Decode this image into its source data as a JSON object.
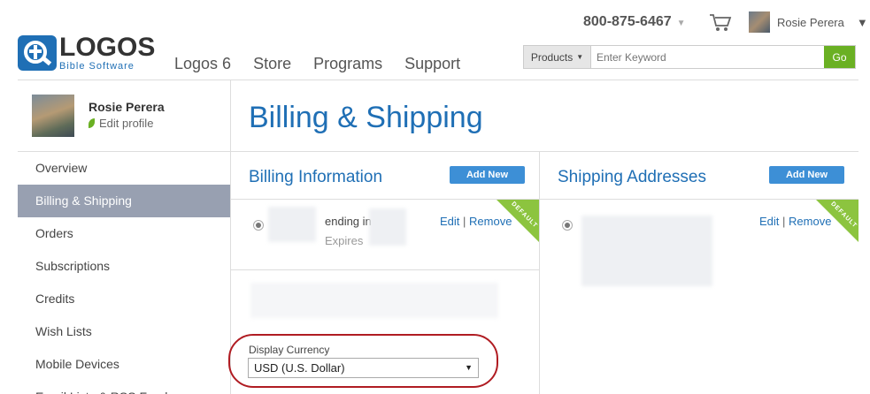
{
  "header": {
    "logo_word": "LOGOS",
    "logo_sub": "Bible Software",
    "nav": [
      "Logos 6",
      "Store",
      "Programs",
      "Support"
    ],
    "phone": "800-875-6467",
    "user_name": "Rosie Perera",
    "search": {
      "category": "Products",
      "placeholder": "Enter Keyword",
      "go_label": "Go"
    }
  },
  "sidebar": {
    "profile_name": "Rosie Perera",
    "edit_profile": "Edit profile",
    "items": [
      {
        "label": "Overview"
      },
      {
        "label": "Billing & Shipping"
      },
      {
        "label": "Orders"
      },
      {
        "label": "Subscriptions"
      },
      {
        "label": "Credits"
      },
      {
        "label": "Wish Lists"
      },
      {
        "label": "Mobile Devices"
      },
      {
        "label": "Email Lists & RSS Feeds"
      }
    ]
  },
  "main": {
    "title": "Billing & Shipping",
    "billing": {
      "title": "Billing Information",
      "add_new": "Add New",
      "card_text": "ending in",
      "card_sub": "Expires",
      "edit": "Edit",
      "sep": "|",
      "remove": "Remove",
      "badge": "DEFAULT"
    },
    "shipping": {
      "title": "Shipping Addresses",
      "add_new": "Add New",
      "edit": "Edit",
      "sep": "|",
      "remove": "Remove",
      "badge": "DEFAULT"
    },
    "currency": {
      "label": "Display Currency",
      "value": "USD (U.S. Dollar)"
    }
  },
  "colors": {
    "brand_blue": "#1f6fb5",
    "go_green": "#6ab023",
    "active_sidebar": "#98a0b1",
    "highlight_red": "#b01c22"
  }
}
